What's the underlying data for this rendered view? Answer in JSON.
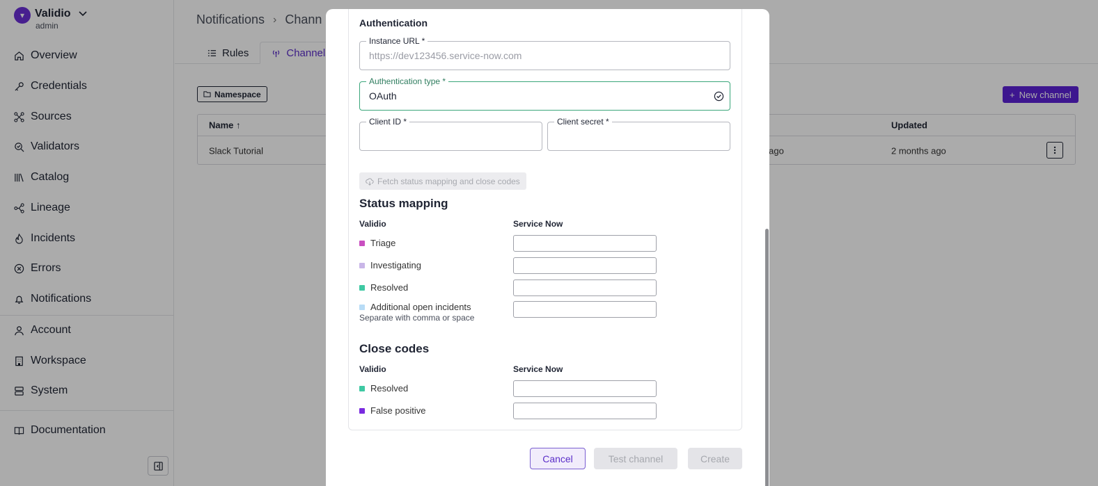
{
  "sidebar": {
    "brand": {
      "name": "Validio",
      "role": "admin"
    },
    "items": [
      {
        "label": "Overview",
        "icon": "home-icon"
      },
      {
        "label": "Credentials",
        "icon": "key-icon"
      },
      {
        "label": "Sources",
        "icon": "sources-icon"
      },
      {
        "label": "Validators",
        "icon": "validators-icon"
      },
      {
        "label": "Catalog",
        "icon": "catalog-icon"
      },
      {
        "label": "Lineage",
        "icon": "lineage-icon"
      },
      {
        "label": "Incidents",
        "icon": "flame-icon"
      },
      {
        "label": "Errors",
        "icon": "error-icon"
      },
      {
        "label": "Notifications",
        "icon": "bell-icon"
      },
      {
        "label": "Account",
        "icon": "user-icon"
      },
      {
        "label": "Workspace",
        "icon": "building-icon"
      },
      {
        "label": "System",
        "icon": "server-icon"
      },
      {
        "label": "Documentation",
        "icon": "book-icon"
      }
    ]
  },
  "main": {
    "breadcrumb": [
      "Notifications",
      "Chann"
    ],
    "tabs": [
      {
        "label": "Rules",
        "icon": "list-icon"
      },
      {
        "label": "Channels",
        "icon": "broadcast-icon"
      }
    ],
    "namespace_chip": "Namespace",
    "new_channel": "New channel",
    "table": {
      "headers": {
        "name": "Name",
        "updated": "Updated"
      },
      "rows": [
        {
          "name": "Slack Tutorial",
          "created": "s ago",
          "updated": "2 months ago"
        }
      ]
    }
  },
  "modal": {
    "auth_title": "Authentication",
    "instance_url": {
      "label": "Instance URL *",
      "placeholder": "https://dev123456.service-now.com",
      "value": ""
    },
    "auth_type": {
      "label": "Authentication type *",
      "value": "OAuth"
    },
    "client_id": {
      "label": "Client ID *",
      "value": ""
    },
    "client_secret": {
      "label": "Client secret *",
      "value": ""
    },
    "fetch_button": "Fetch status mapping and close codes",
    "status_mapping": {
      "title": "Status mapping",
      "col_left": "Validio",
      "col_right": "Service Now",
      "rows": [
        {
          "label": "Triage",
          "color": "#c94fc0"
        },
        {
          "label": "Investigating",
          "color": "#c9b6e8"
        },
        {
          "label": "Resolved",
          "color": "#3fc9a3"
        },
        {
          "label": "Additional open incidents",
          "color": "#b8dcf6",
          "help": "Separate with comma or space"
        }
      ]
    },
    "close_codes": {
      "title": "Close codes",
      "col_left": "Validio",
      "col_right": "Service Now",
      "rows": [
        {
          "label": "Resolved",
          "color": "#3fc9a3"
        },
        {
          "label": "False positive",
          "color": "#7a2be0"
        }
      ]
    },
    "buttons": {
      "cancel": "Cancel",
      "test": "Test channel",
      "create": "Create"
    }
  },
  "colors": {
    "accent": "#5b21d6",
    "success": "#3aa67a"
  }
}
